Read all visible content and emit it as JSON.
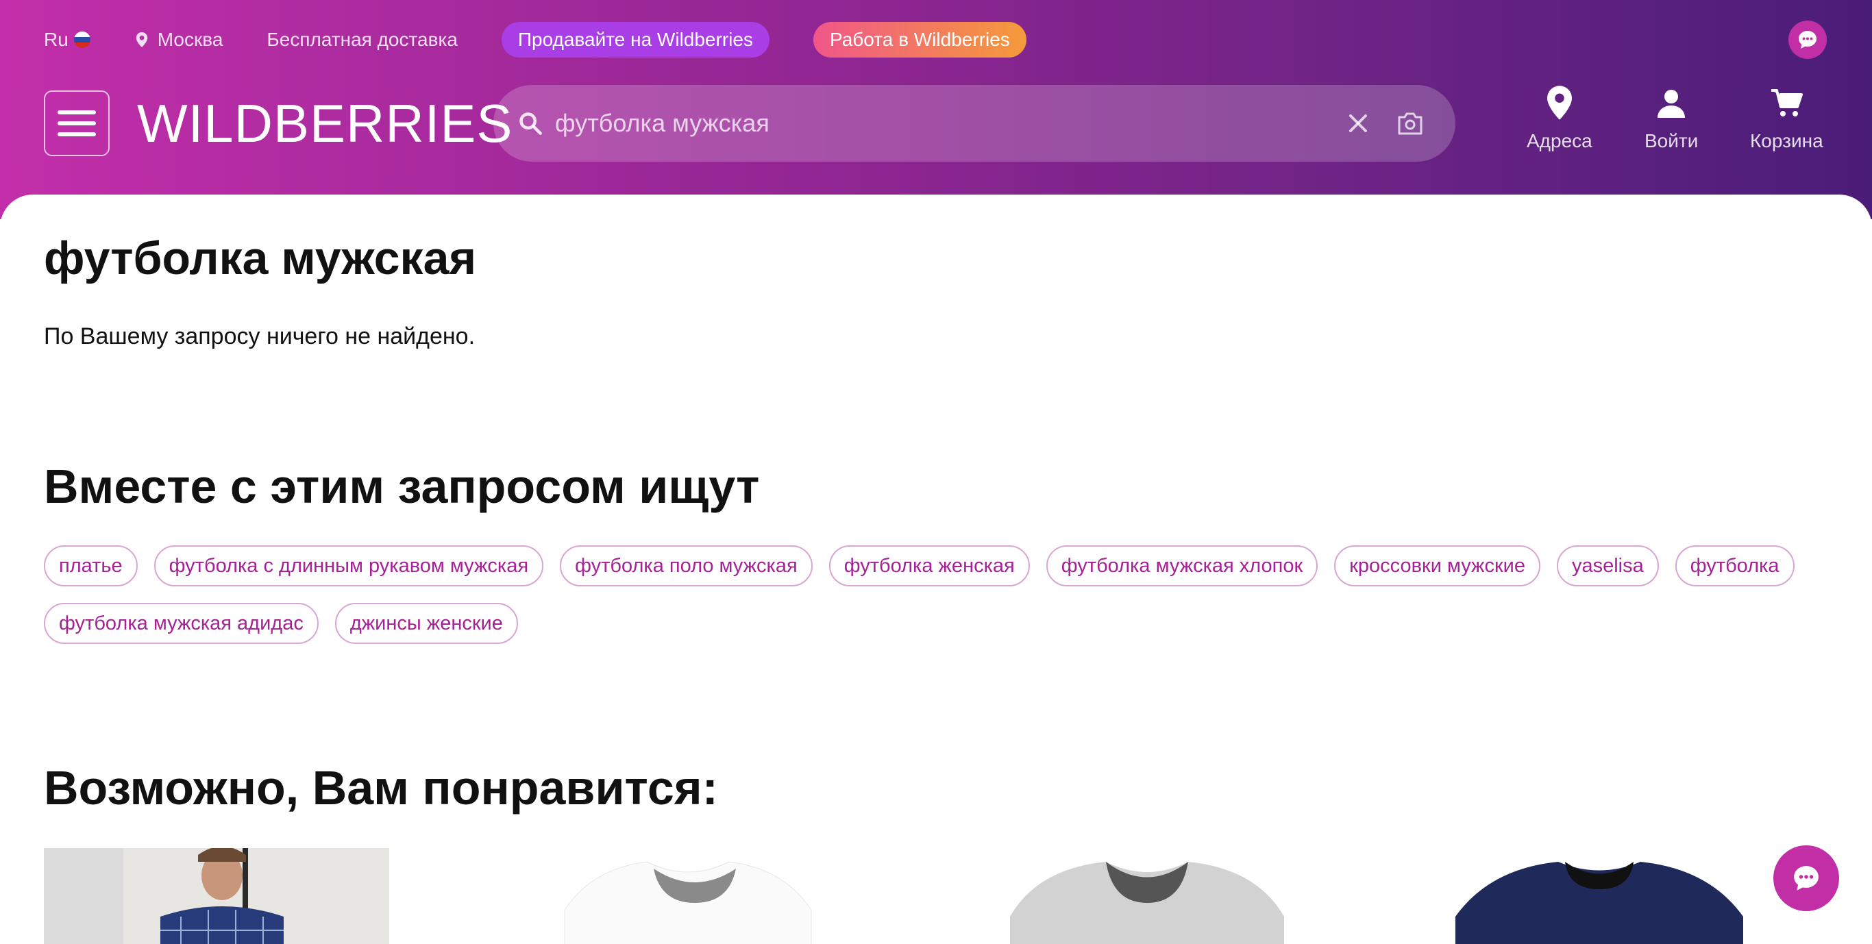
{
  "topbar": {
    "lang": "Ru",
    "city": "Москва",
    "free_delivery": "Бесплатная доставка",
    "sell": "Продавайте на Wildberries",
    "job": "Работа в Wildberries"
  },
  "header": {
    "logo": "WILDBERRIES",
    "search_value": "футболка мужская",
    "addresses": "Адреса",
    "login": "Войти",
    "cart": "Корзина"
  },
  "main": {
    "title": "футболка мужская",
    "not_found": "По Вашему запросу ничего не найдено.",
    "related_title": "Вместе с этим запросом ищут",
    "related_tags": [
      "платье",
      "футболка с длинным рукавом мужская",
      "футболка поло мужская",
      "футболка женская",
      "футболка мужская хлопок",
      "кроссовки мужские",
      "yaselisa",
      "футболка",
      "футболка мужская адидас",
      "джинсы женские"
    ],
    "maybe_title": "Возможно, Вам понравится:"
  },
  "colors": {
    "brand_gradient_start": "#c22ea9",
    "brand_gradient_end": "#4a1d78",
    "tag_text": "#a42296",
    "tag_border": "#d9a6d4",
    "sell_pill": "#a93ee6",
    "chat": "#c12ea5"
  }
}
